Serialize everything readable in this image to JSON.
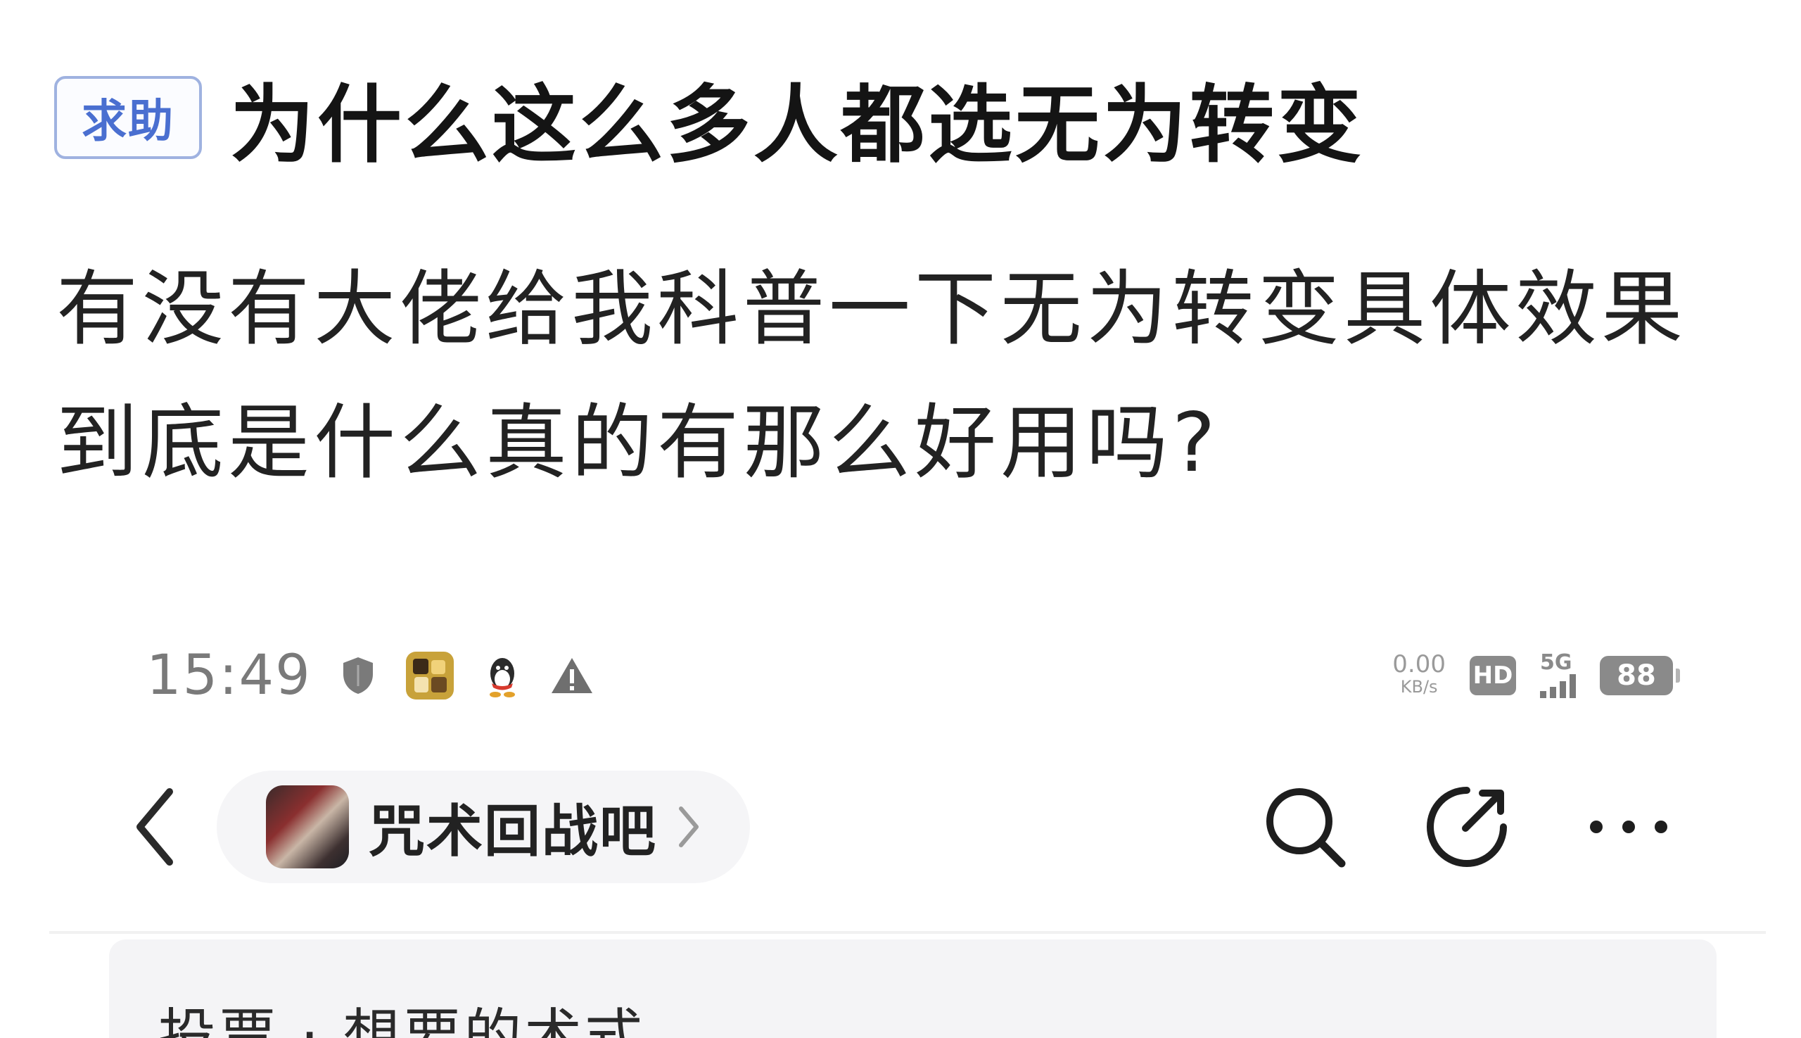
{
  "post": {
    "tag": "求助",
    "title": "为什么这么多人都选无为转变",
    "body_lines": [
      "有没有大佬给我科普一下无为转变具体效果",
      "到底是什么真的有那么好用吗?"
    ]
  },
  "status_bar": {
    "time": "15:49",
    "icons_left": [
      "shield-icon",
      "game-app-icon",
      "qq-penguin-icon",
      "warning-icon"
    ],
    "net_speed_value": "0.00",
    "net_speed_unit": "KB/s",
    "hd_label": "HD",
    "network_label": "5G",
    "battery_level": "88"
  },
  "nav": {
    "back_icon": "chevron-left-icon",
    "forum_name": "咒术回战吧",
    "actions": [
      "search-icon",
      "share-icon",
      "more-icon"
    ]
  },
  "card": {
    "text": "投票 · 想要的术式"
  }
}
